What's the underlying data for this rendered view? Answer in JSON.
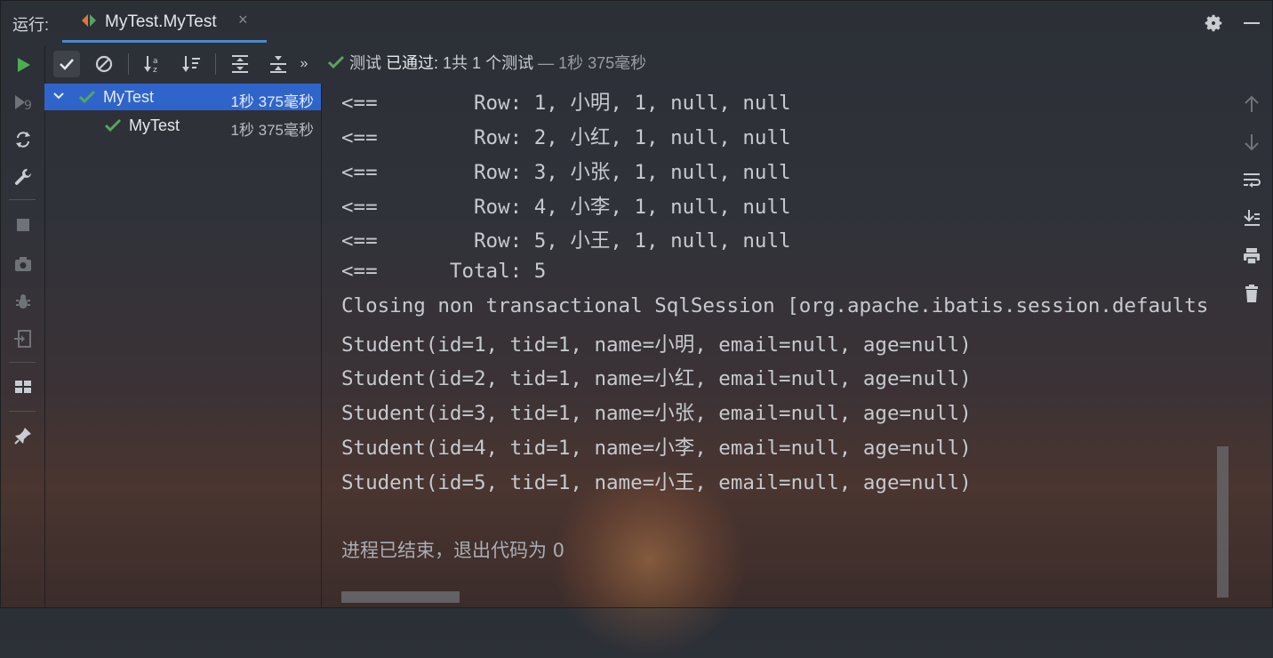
{
  "topbar": {
    "run_label": "运行:",
    "tab_title": "MyTest.MyTest",
    "tab_close": "×"
  },
  "status": {
    "prefix": "测试 ",
    "passed": "已通过:",
    "count": " 1共 1 个测试",
    "time": " — 1秒 375毫秒"
  },
  "tree": {
    "items": [
      {
        "name": "MyTest",
        "time": "1秒 375毫秒"
      },
      {
        "name": "MyTest",
        "time": "1秒 375毫秒"
      }
    ]
  },
  "console": {
    "lines": [
      "<==        Row: 1, 小明, 1, null, null",
      "<==        Row: 2, 小红, 1, null, null",
      "<==        Row: 3, 小张, 1, null, null",
      "<==        Row: 4, 小李, 1, null, null",
      "<==        Row: 5, 小王, 1, null, null",
      "<==      Total: 5",
      "Closing non transactional SqlSession [org.apache.ibatis.session.defaults",
      "Student(id=1, tid=1, name=小明, email=null, age=null)",
      "Student(id=2, tid=1, name=小红, email=null, age=null)",
      "Student(id=3, tid=1, name=小张, email=null, age=null)",
      "Student(id=4, tid=1, name=小李, email=null, age=null)",
      "Student(id=5, tid=1, name=小王, email=null, age=null)"
    ],
    "finish": "进程已结束，退出代码为 0"
  },
  "colors": {
    "accent": "#4a88c7",
    "selection": "#2f65ca",
    "pass_green": "#5aa35f",
    "run_green": "#4cae4f"
  }
}
